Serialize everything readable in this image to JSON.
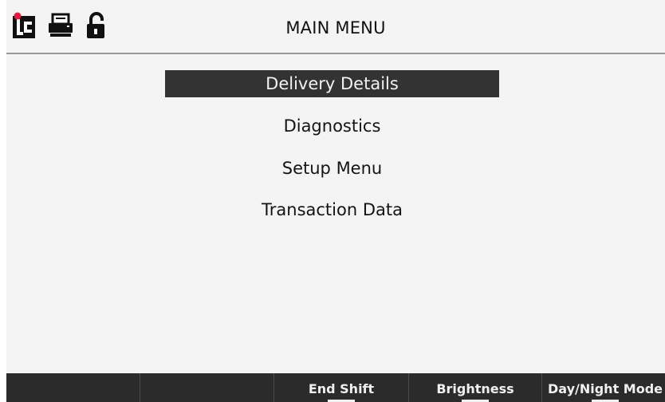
{
  "header": {
    "title": "MAIN MENU",
    "icons": [
      "lc-logo-icon",
      "printer-icon",
      "unlocked-padlock-icon"
    ]
  },
  "menu": {
    "items": [
      {
        "label": "Delivery Details",
        "selected": true
      },
      {
        "label": "Diagnostics",
        "selected": false
      },
      {
        "label": "Setup Menu",
        "selected": false
      },
      {
        "label": "Transaction Data",
        "selected": false
      }
    ]
  },
  "softkeys": [
    {
      "label": ""
    },
    {
      "label": ""
    },
    {
      "label": "End Shift"
    },
    {
      "label": "Brightness"
    },
    {
      "label": "Day/Night Mode"
    }
  ],
  "colors": {
    "background": "#f4f4f4",
    "selected_bg": "#333333",
    "selected_text": "#f2f2f2",
    "softkey_bar": "#2b2b2b",
    "logo_accent": "#e8193c"
  }
}
